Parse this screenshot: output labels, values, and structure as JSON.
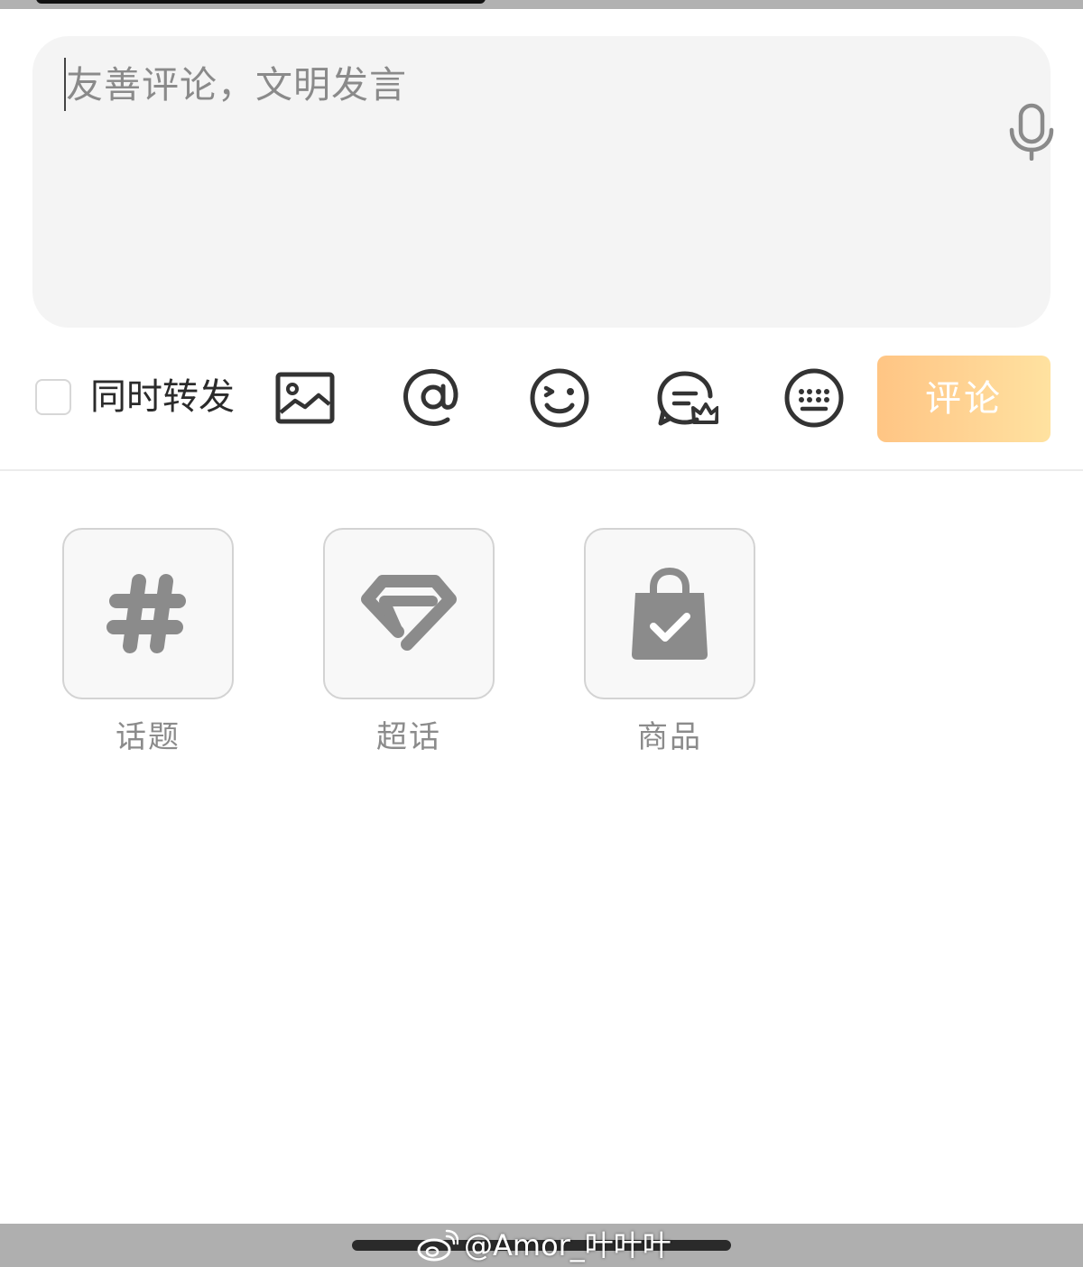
{
  "input": {
    "placeholder": "友善评论，文明发言",
    "voice_icon": "microphone-icon"
  },
  "toolbar": {
    "repost_label": "同时转发",
    "repost_checked": false,
    "icons": [
      "image-icon",
      "at-mention-icon",
      "emoji-icon",
      "super-chat-icon",
      "keyboard-icon"
    ],
    "submit_label": "评论",
    "submit_gradient": [
      "#ffc584",
      "#ffe2a0"
    ]
  },
  "panel": {
    "items": [
      {
        "label": "话题",
        "icon": "hashtag-icon"
      },
      {
        "label": "超话",
        "icon": "super-topic-diamond-icon"
      },
      {
        "label": "商品",
        "icon": "shopping-bag-check-icon"
      }
    ]
  },
  "watermark": {
    "text": "@Amor_叶叶叶",
    "icon": "weibo-logo-icon"
  }
}
